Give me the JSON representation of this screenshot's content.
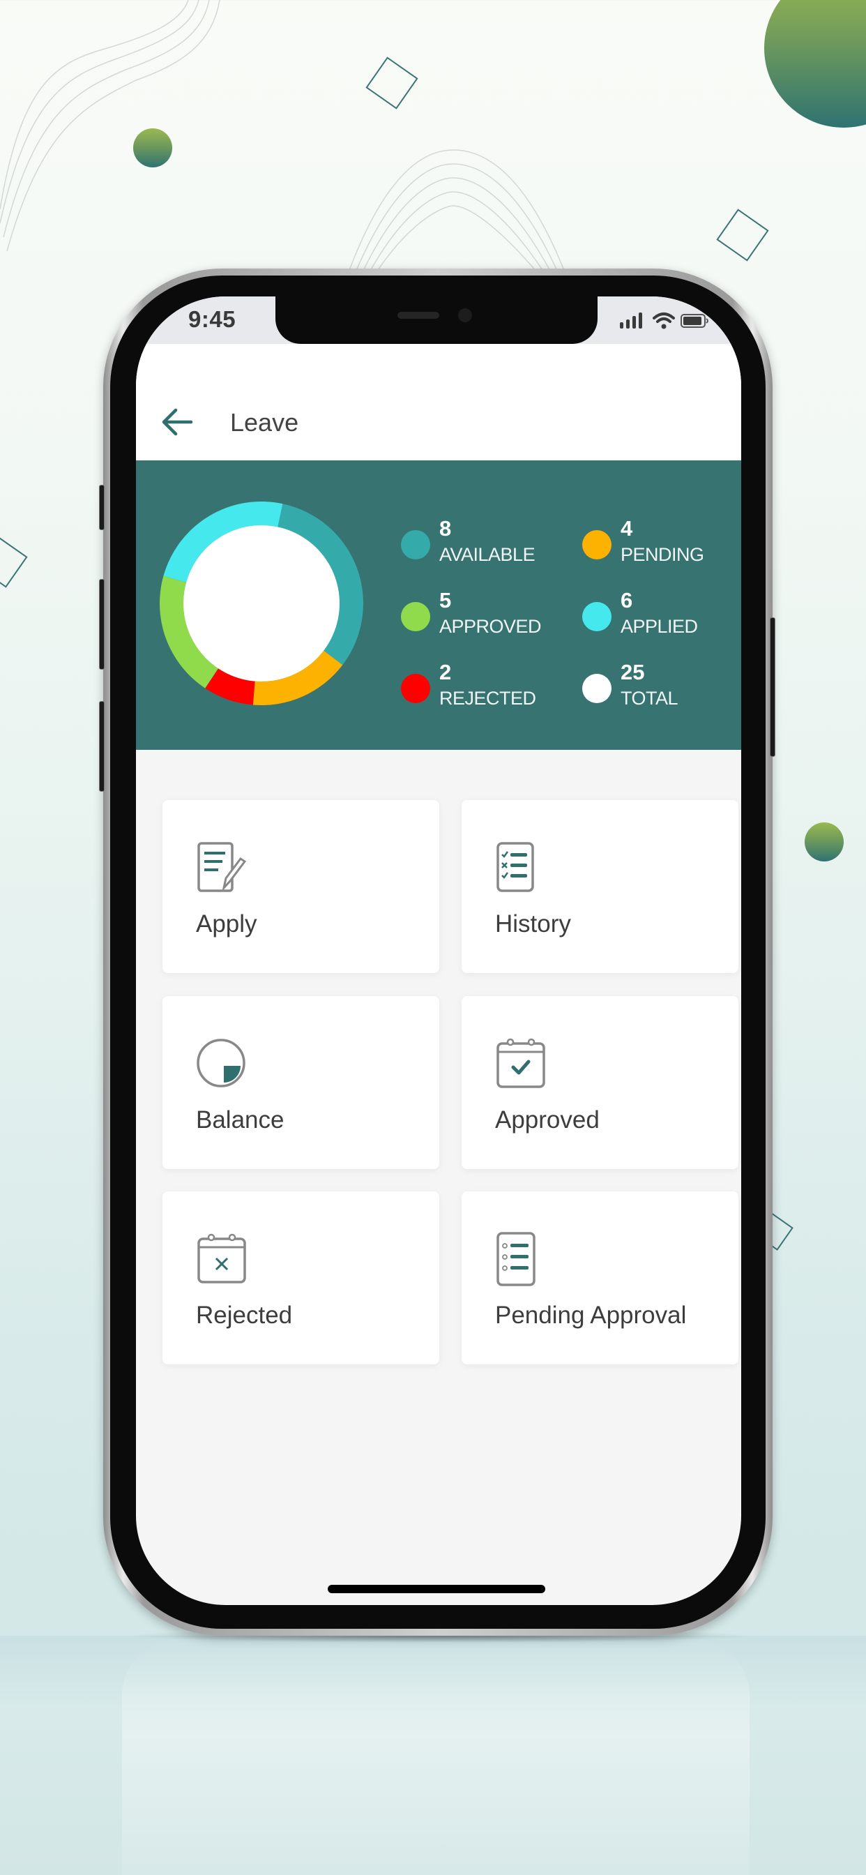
{
  "status_bar": {
    "time": "9:45",
    "icons": [
      "cellular-signal-icon",
      "wifi-icon",
      "battery-icon"
    ]
  },
  "header": {
    "back_icon": "arrow-left-icon",
    "title": "Leave"
  },
  "colors": {
    "brand": "#377371",
    "available": "#35aaaa",
    "pending": "#fdb100",
    "rejected": "#ff0000",
    "approved": "#8fdb4b",
    "applied": "#45e8ec",
    "total": "#ffffff"
  },
  "summary": {
    "legend": [
      {
        "key": "available",
        "value": "8",
        "label": "AVAILABLE"
      },
      {
        "key": "pending",
        "value": "4",
        "label": "PENDING"
      },
      {
        "key": "approved",
        "value": "5",
        "label": "APPROVED"
      },
      {
        "key": "applied",
        "value": "6",
        "label": "APPLIED"
      },
      {
        "key": "rejected",
        "value": "2",
        "label": "REJECTED"
      },
      {
        "key": "total",
        "value": "25",
        "label": "TOTAL"
      }
    ]
  },
  "chart_data": {
    "type": "pie",
    "title": "",
    "donut": true,
    "categories": [
      "AVAILABLE",
      "PENDING",
      "REJECTED",
      "APPROVED",
      "APPLIED"
    ],
    "values": [
      8,
      4,
      2,
      5,
      6
    ],
    "colors": [
      "#35aaaa",
      "#fdb100",
      "#ff0000",
      "#8fdb4b",
      "#45e8ec"
    ],
    "total": 25,
    "legend": "right"
  },
  "menu": {
    "items": [
      {
        "label": "Apply",
        "icon": "apply-form-icon"
      },
      {
        "label": "History",
        "icon": "history-checklist-icon"
      },
      {
        "label": "Balance",
        "icon": "balance-pie-icon"
      },
      {
        "label": "Approved",
        "icon": "calendar-check-icon"
      },
      {
        "label": "Rejected",
        "icon": "calendar-x-icon"
      },
      {
        "label": "Pending Approval",
        "icon": "pending-list-icon"
      }
    ]
  }
}
